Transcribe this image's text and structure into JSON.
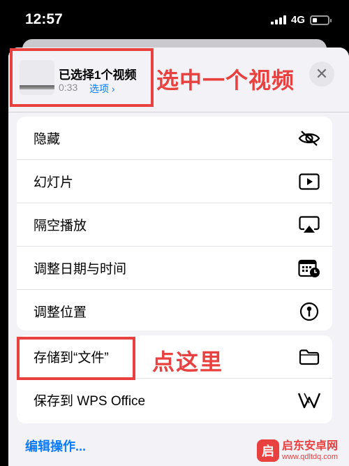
{
  "status_bar": {
    "time": "12:57",
    "network": "4G"
  },
  "header": {
    "title": "已选择1个视频",
    "duration": "0:33",
    "options_label": "选项 ›",
    "annotation": "选中一个视频",
    "close_glyph": "✕"
  },
  "actions_group1": [
    {
      "label": "隐藏",
      "icon": "eye-slash-icon"
    },
    {
      "label": "幻灯片",
      "icon": "play-icon"
    },
    {
      "label": "隔空播放",
      "icon": "airplay-icon"
    },
    {
      "label": "调整日期与时间",
      "icon": "calendar-clock-icon"
    },
    {
      "label": "调整位置",
      "icon": "location-pin-icon"
    }
  ],
  "actions_group2": [
    {
      "label": "存储到“文件”",
      "icon": "folder-icon"
    },
    {
      "label": "保存到 WPS Office",
      "icon": "wps-icon"
    }
  ],
  "annotation2": "点这里",
  "edit_actions": "编辑操作...",
  "watermark": {
    "logo": "启",
    "name": "启东安卓网",
    "url": "www.qdltdq.com"
  },
  "colors": {
    "accent": "#0a7cff",
    "annotation": "#e8413f"
  }
}
